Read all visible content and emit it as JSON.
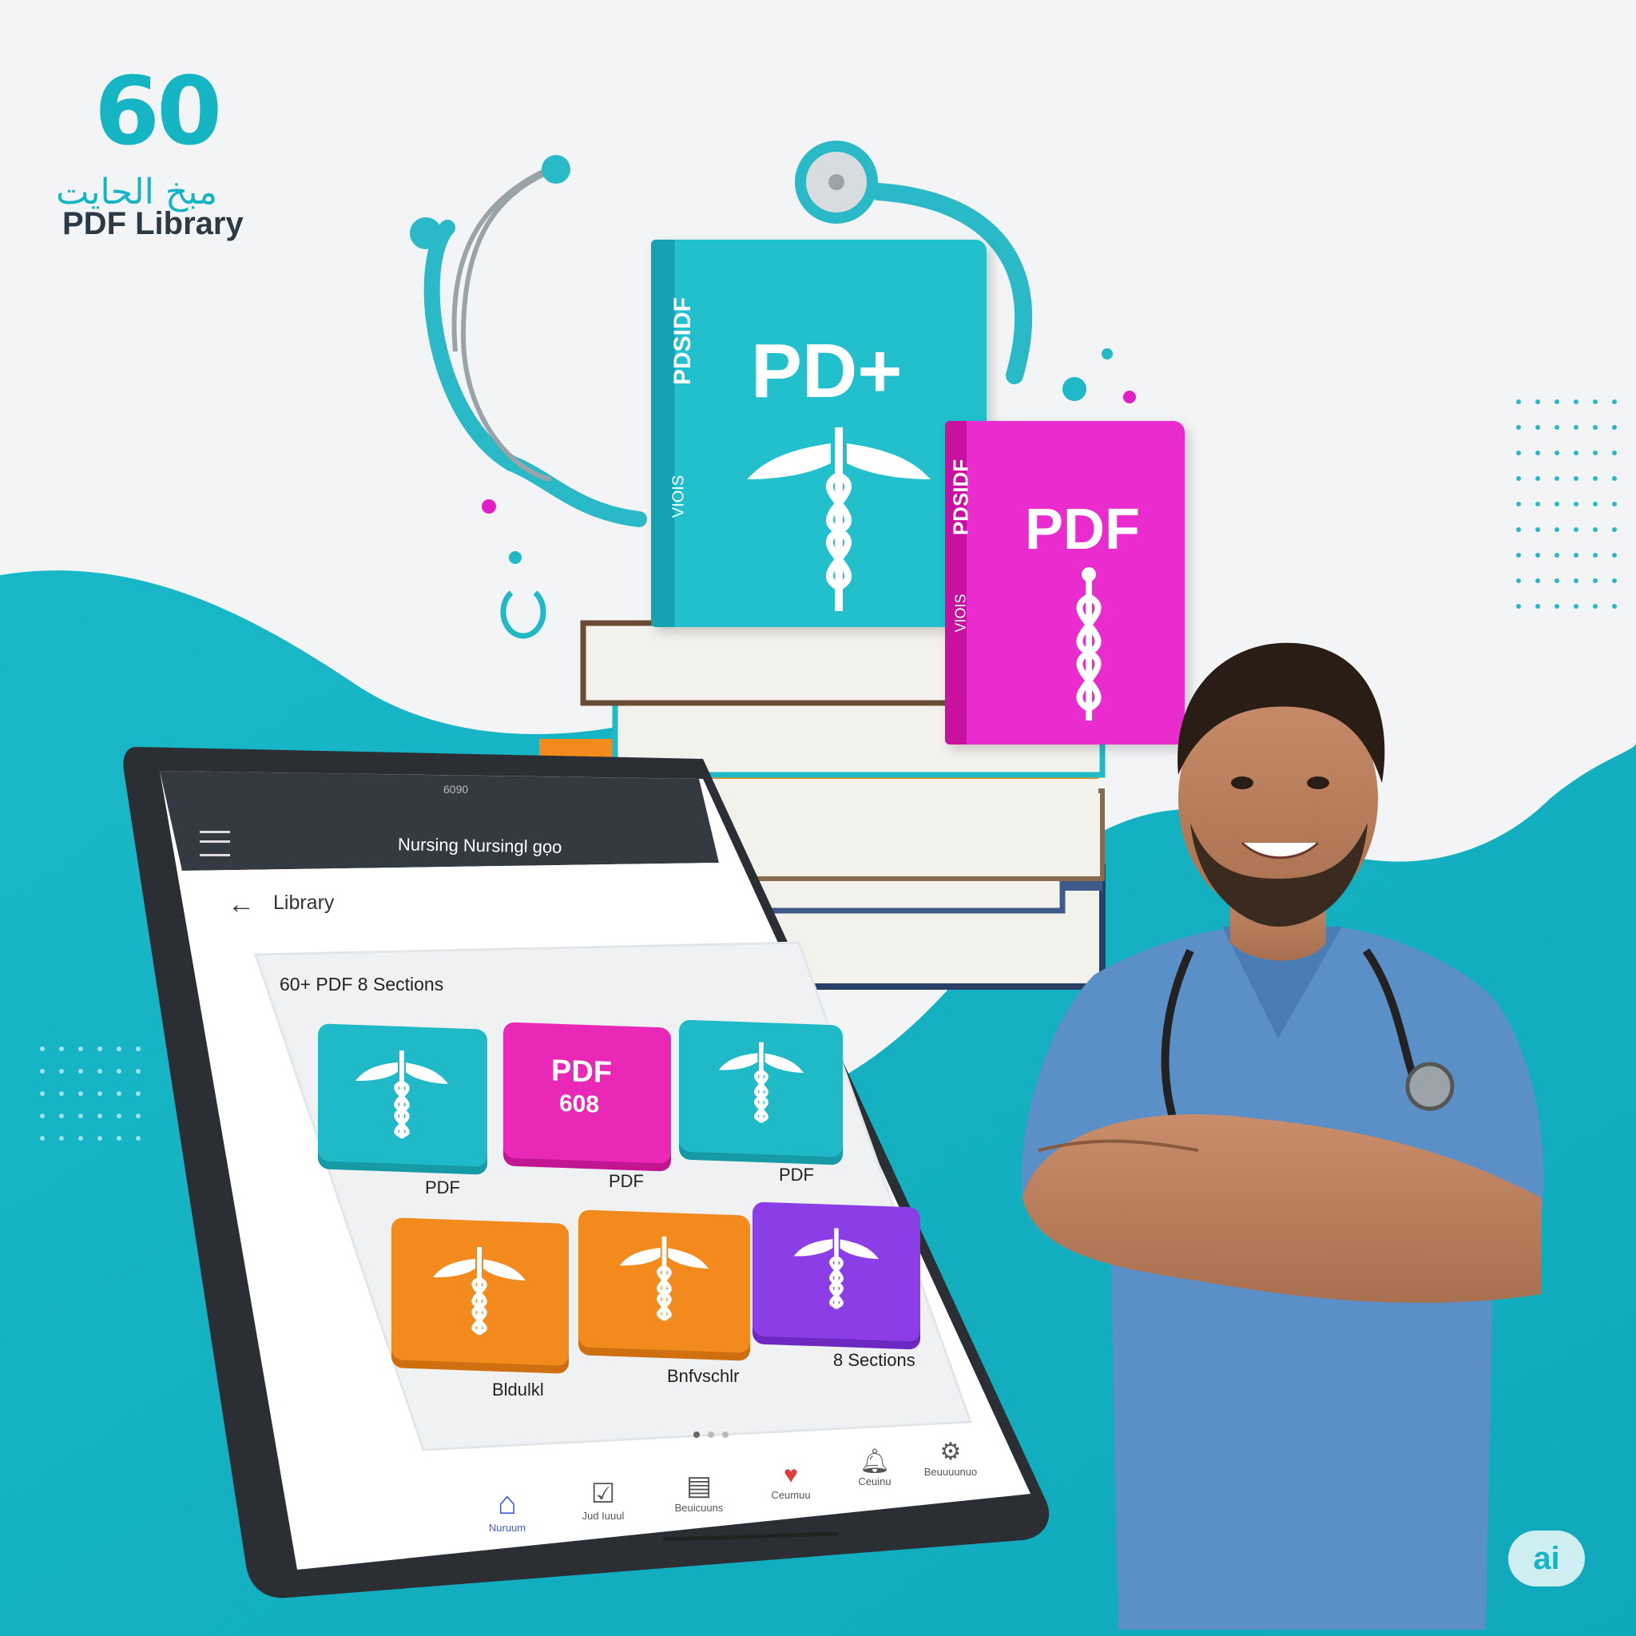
{
  "branding": {
    "logo_number": "60",
    "logo_arabic": "مبخ الحايت",
    "logo_english": "PDF Library",
    "ai_badge": "ai"
  },
  "colors": {
    "teal": "#1fb9c7",
    "magenta": "#e21fc4",
    "orange": "#f28a1e",
    "purple": "#8b3ee6",
    "scrubs": "#5a8fc7",
    "dark_text": "#2c3a45"
  },
  "books": {
    "teal_title": "PD+",
    "teal_spine": "PDSIDF",
    "teal_spine_small": "VIOIS",
    "magenta_title": "PDF",
    "magenta_spine": "PDSIDF",
    "magenta_spine_small": "VIOIS"
  },
  "tablet": {
    "status_time": "6090",
    "header_title": "Nursing Nursingl ɡọo",
    "back_label": "Library",
    "stats_text": "60+ PDF  8 Sections",
    "tiles": [
      {
        "label": "PDF",
        "color": "teal",
        "icon": "caduceus-icon"
      },
      {
        "label": "PDF",
        "color": "magenta",
        "icon": "pdf-icon",
        "badge_top": "PDF",
        "badge_bottom": "608"
      },
      {
        "label": "PDF",
        "color": "teal",
        "icon": "caduceus-icon"
      },
      {
        "label": "Bldulkl",
        "color": "orange",
        "icon": "caduceus-icon"
      },
      {
        "label": "Bnfvschlr",
        "color": "orange",
        "icon": "caduceus-icon"
      },
      {
        "label": "8 Sections",
        "color": "purple",
        "icon": "caduceus-icon"
      }
    ],
    "nav": [
      {
        "label": "Nuruum",
        "icon": "home-icon"
      },
      {
        "label": "Jud Iuuul",
        "icon": "checkbox-icon"
      },
      {
        "label": "Beuicuuns",
        "icon": "card-icon"
      },
      {
        "label": "Ceumuu",
        "icon": "heart-icon"
      },
      {
        "label": "Ceuinu",
        "icon": "bell-icon"
      },
      {
        "label": "Beuuuunuo",
        "icon": "gear-icon"
      }
    ]
  }
}
